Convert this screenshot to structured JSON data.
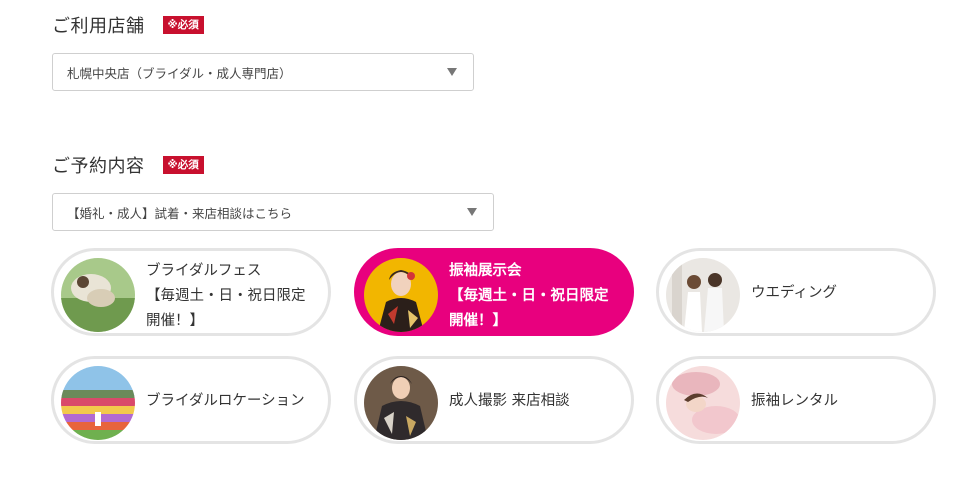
{
  "store": {
    "label": "ご利用店舗",
    "required_badge": "※必須",
    "selected": "札幌中央店（ブライダル・成人専門店）"
  },
  "reservation": {
    "label": "ご予約内容",
    "required_badge": "※必須",
    "selected": "【婚礼・成人】試着・来店相談はこちら"
  },
  "cards": [
    {
      "line1": "ブライダルフェス",
      "line2": "【毎週土・日・祝日限定",
      "line3": "開催！】",
      "image": "bride-outdoor-photo",
      "selected": false
    },
    {
      "line1": "振袖展示会",
      "line2": "【毎週土・日・祝日限定",
      "line3": "開催！】",
      "image": "furisode-woman-photo",
      "selected": true
    },
    {
      "line1": "ウエディング",
      "line2": "",
      "line3": "",
      "image": "wedding-couple-photo",
      "selected": false
    },
    {
      "line1": "ブライダルロケーション",
      "line2": "",
      "line3": "",
      "image": "flower-field-photo",
      "selected": false
    },
    {
      "line1": "成人撮影 来店相談",
      "line2": "",
      "line3": "",
      "image": "seijin-kimono-photo",
      "selected": false
    },
    {
      "line1": "振袖レンタル",
      "line2": "",
      "line3": "",
      "image": "reclining-woman-photo",
      "selected": false
    }
  ],
  "colors": {
    "accent": "#e8007e",
    "required": "#c8102e",
    "border": "#e4e4e4"
  }
}
